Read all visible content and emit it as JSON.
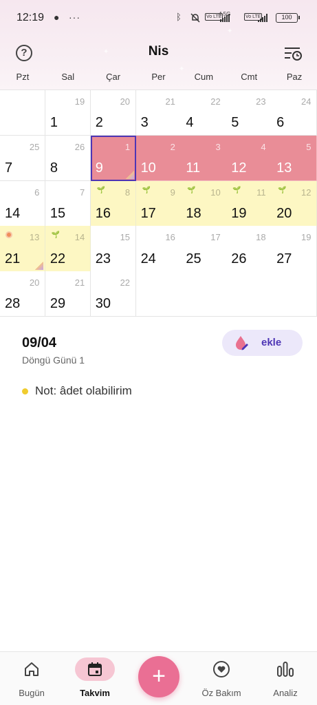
{
  "status_bar": {
    "time": "12:19",
    "network_label": "4.5G",
    "volte_label": "Vo LTE",
    "battery": "100"
  },
  "header": {
    "month": "Nis",
    "weekdays": [
      "Pzt",
      "Sal",
      "Çar",
      "Per",
      "Cum",
      "Cmt",
      "Paz"
    ]
  },
  "calendar": {
    "selected_day": "9",
    "rows": [
      [
        {
          "day": "",
          "sub": "",
          "type": "empty"
        },
        {
          "day": "1",
          "sub": "19",
          "type": "normal"
        },
        {
          "day": "2",
          "sub": "20",
          "type": "normal"
        },
        {
          "day": "3",
          "sub": "21",
          "type": "normal"
        },
        {
          "day": "4",
          "sub": "22",
          "type": "normal"
        },
        {
          "day": "5",
          "sub": "23",
          "type": "normal"
        },
        {
          "day": "6",
          "sub": "24",
          "type": "normal"
        }
      ],
      [
        {
          "day": "7",
          "sub": "25",
          "type": "normal"
        },
        {
          "day": "8",
          "sub": "26",
          "type": "normal"
        },
        {
          "day": "9",
          "sub": "1",
          "type": "period",
          "note": true
        },
        {
          "day": "10",
          "sub": "2",
          "type": "period"
        },
        {
          "day": "11",
          "sub": "3",
          "type": "period"
        },
        {
          "day": "12",
          "sub": "4",
          "type": "period"
        },
        {
          "day": "13",
          "sub": "5",
          "type": "period"
        }
      ],
      [
        {
          "day": "14",
          "sub": "6",
          "type": "normal"
        },
        {
          "day": "15",
          "sub": "7",
          "type": "normal"
        },
        {
          "day": "16",
          "sub": "8",
          "type": "fertile",
          "sprout": true
        },
        {
          "day": "17",
          "sub": "9",
          "type": "fertile",
          "sprout": true
        },
        {
          "day": "18",
          "sub": "10",
          "type": "fertile",
          "sprout": true
        },
        {
          "day": "19",
          "sub": "11",
          "type": "fertile",
          "sprout": true
        },
        {
          "day": "20",
          "sub": "12",
          "type": "fertile",
          "sprout": true
        }
      ],
      [
        {
          "day": "21",
          "sub": "13",
          "type": "fertile",
          "ovulation": true,
          "note": true
        },
        {
          "day": "22",
          "sub": "14",
          "type": "fertile",
          "sprout": true
        },
        {
          "day": "23",
          "sub": "15",
          "type": "normal"
        },
        {
          "day": "24",
          "sub": "16",
          "type": "normal"
        },
        {
          "day": "25",
          "sub": "17",
          "type": "normal"
        },
        {
          "day": "26",
          "sub": "18",
          "type": "normal"
        },
        {
          "day": "27",
          "sub": "19",
          "type": "normal"
        }
      ],
      [
        {
          "day": "28",
          "sub": "20",
          "type": "normal"
        },
        {
          "day": "29",
          "sub": "21",
          "type": "normal"
        },
        {
          "day": "30",
          "sub": "22",
          "type": "normal"
        },
        {
          "day": "",
          "sub": "",
          "type": "empty"
        },
        {
          "day": "",
          "sub": "",
          "type": "empty"
        },
        {
          "day": "",
          "sub": "",
          "type": "empty"
        },
        {
          "day": "",
          "sub": "",
          "type": "empty"
        }
      ]
    ]
  },
  "detail": {
    "date": "09/04",
    "cycle_day": "Döngü Günü 1",
    "add_label": "ekle",
    "note": "Not: âdet olabilirim"
  },
  "bottom_nav": {
    "items": [
      {
        "label": "Bugün",
        "icon": "home-icon",
        "active": false
      },
      {
        "label": "Takvim",
        "icon": "calendar-icon",
        "active": true
      },
      {
        "label": "Öz Bakım",
        "icon": "heart-circle-icon",
        "active": false
      },
      {
        "label": "Analiz",
        "icon": "bar-chart-icon",
        "active": false
      }
    ],
    "fab_label": "+"
  },
  "colors": {
    "period": "#e98d97",
    "fertile": "#fdf7c3",
    "accent": "#4d35b5",
    "fab": "#ea6f94",
    "active_tab": "#f6c6d3"
  }
}
